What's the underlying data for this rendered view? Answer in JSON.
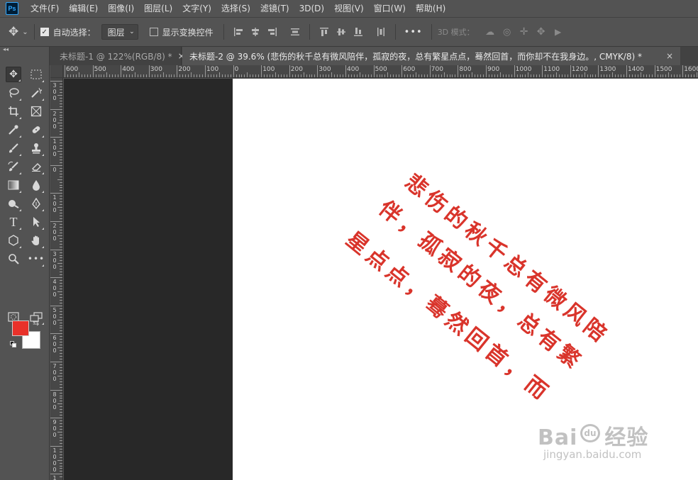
{
  "app": {
    "logo": "Ps"
  },
  "menu": [
    "文件(F)",
    "编辑(E)",
    "图像(I)",
    "图层(L)",
    "文字(Y)",
    "选择(S)",
    "滤镜(T)",
    "3D(D)",
    "视图(V)",
    "窗口(W)",
    "帮助(H)"
  ],
  "options": {
    "auto_select_label": "自动选择：",
    "auto_select_checked": true,
    "auto_select_target": "图层",
    "show_transform_label": "显示变换控件",
    "show_transform_checked": false,
    "more": "•••",
    "mode_3d_label": "3D 模式："
  },
  "tabs": [
    {
      "label": "未标题-1 @ 122%(RGB/8) *",
      "active": false,
      "close": "×"
    },
    {
      "label": "未标题-2 @ 39.6% (悲伤的秋千总有微风陪伴，孤寂的夜，总有繁星点点，蓦然回首，而你却不在我身边。, CMYK/8) *",
      "active": true,
      "close": "×"
    }
  ],
  "ruler": {
    "top_labels": [
      "600",
      "500",
      "400",
      "300",
      "200",
      "100",
      "0",
      "100",
      "200",
      "300",
      "400",
      "500",
      "600",
      "700",
      "800",
      "900",
      "1000",
      "1100",
      "1200",
      "1300",
      "1400",
      "1500",
      "1600"
    ],
    "left_labels": [
      "3\n0\n0",
      "2\n0\n0",
      "1\n0\n0",
      "0",
      "1\n0\n0",
      "2\n0\n0",
      "3\n0\n0",
      "4\n0\n0",
      "5\n0\n0",
      "6\n0\n0",
      "7\n0\n0",
      "8\n0\n0",
      "9\n0\n0",
      "1\n0\n0\n0",
      "1\n1\n0\n0",
      "1\n2\n0\n0",
      "1\n3\n0\n0",
      "1\n4\n0\n0",
      "1\n5\n0\n0",
      "1\n6\n0\n0"
    ]
  },
  "colors": {
    "foreground": "#e8312a",
    "background": "#ffffff",
    "text": "#d9342b"
  },
  "canvas_text": {
    "lines": [
      "悲伤的秋千总有微风陪",
      "伴，孤寂的夜，总有繁",
      "星点点，蓦然回首，而"
    ]
  },
  "watermark": {
    "brand_left": "Bai",
    "brand_paw": "du",
    "brand_right": "经验",
    "url": "jingyan.baidu.com"
  },
  "icons": {
    "move": "move-icon",
    "marquee": "rectangular-marquee-icon",
    "lasso": "lasso-icon",
    "magic-wand": "magic-wand-icon",
    "crop": "crop-icon",
    "frame": "frame-icon",
    "eyedropper": "eyedropper-icon",
    "healing": "healing-brush-icon",
    "brush": "brush-icon",
    "stamp": "clone-stamp-icon",
    "history-brush": "history-brush-icon",
    "eraser": "eraser-icon",
    "gradient": "gradient-icon",
    "blur": "blur-icon",
    "dodge": "dodge-icon",
    "pen": "pen-icon",
    "type": "type-icon",
    "path-select": "path-selection-icon",
    "shape": "shape-icon",
    "hand": "hand-icon",
    "zoom": "zoom-icon",
    "more": "more-tools-icon",
    "quick-mask": "quick-mask-icon",
    "screen-mode": "screen-mode-icon"
  }
}
